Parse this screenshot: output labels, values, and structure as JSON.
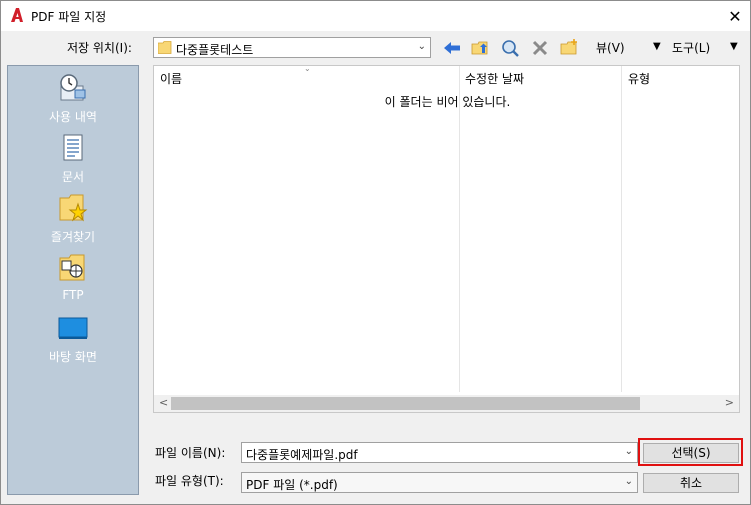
{
  "window": {
    "title": "PDF 파일 지정",
    "close_glyph": "✕"
  },
  "toolbar": {
    "location_label": "저장 위치(I):",
    "location_value": "다중플롯테스트",
    "view_label": "뷰(V)",
    "tools_label": "도구(L)"
  },
  "places": [
    {
      "label": "사용 내역",
      "icon": "history-icon"
    },
    {
      "label": "문서",
      "icon": "documents-icon"
    },
    {
      "label": "즐겨찾기",
      "icon": "favorites-icon"
    },
    {
      "label": "FTP",
      "icon": "ftp-icon"
    },
    {
      "label": "바탕 화면",
      "icon": "desktop-icon"
    }
  ],
  "filelist": {
    "columns": [
      "이름",
      "수정한 날짜",
      "유형"
    ],
    "empty_message": "이 폴더는 비어 있습니다."
  },
  "bottom": {
    "filename_label": "파일 이름(N):",
    "filename_value": "다중플롯예제파일.pdf",
    "filetype_label": "파일 유형(T):",
    "filetype_value": "PDF 파일 (*.pdf)",
    "select_button": "선택(S)",
    "cancel_button": "취소"
  },
  "colors": {
    "places_bg": "#bccbd9",
    "highlight": "#e01010",
    "folder": "#f8d775"
  }
}
